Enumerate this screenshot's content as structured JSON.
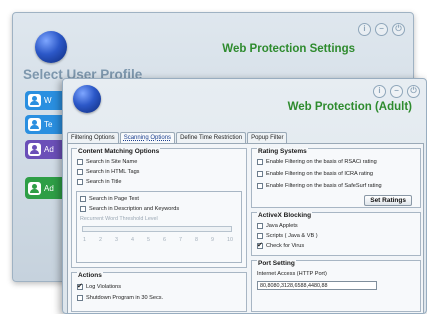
{
  "back_window": {
    "title": "Web Protection Settings",
    "heading": "Select User Profile",
    "controls": [
      "i",
      "−",
      "⏻"
    ],
    "users": [
      {
        "label": "W",
        "color": "#2a8fe0"
      },
      {
        "label": "Te",
        "color": "#2a8fe0"
      },
      {
        "label": "Ad",
        "color": "#6b4fb8"
      },
      {
        "label": "Ad",
        "color": "#2e9e46"
      }
    ]
  },
  "front_window": {
    "title": "Web Protection (Adult)",
    "controls": [
      "i",
      "−",
      "⏻"
    ],
    "tabs": [
      "Filtering Options",
      "Scanning Options",
      "Define Time Restriction",
      "Popup Filter"
    ],
    "active_tab_index": 1,
    "content_matching": {
      "title": "Content Matching Options",
      "options": [
        {
          "label": "Search in Site Name",
          "checked": false
        },
        {
          "label": "Search in HTML Tags",
          "checked": false
        },
        {
          "label": "Search in Title",
          "checked": false
        }
      ],
      "page_options": [
        {
          "label": "Search in Page Text",
          "checked": false
        },
        {
          "label": "Search in Description and Keywords",
          "checked": false
        }
      ],
      "threshold_label": "Recurrent Word Threshold Level",
      "ticks": [
        "1",
        "2",
        "3",
        "4",
        "5",
        "6",
        "7",
        "8",
        "9",
        "10"
      ]
    },
    "rating_systems": {
      "title": "Rating Systems",
      "options": [
        {
          "label": "Enable Filtering on the basis of RSACi rating",
          "checked": false
        },
        {
          "label": "Enable Filtering on the basis of ICRA rating",
          "checked": false
        },
        {
          "label": "Enable Filtering on the basis of SafeSurf rating",
          "checked": false
        }
      ],
      "button": "Set Ratings"
    },
    "activex": {
      "title": "ActiveX Blocking",
      "options": [
        {
          "label": "Java Applets",
          "checked": false
        },
        {
          "label": "Scripts ( Java & VB )",
          "checked": false
        },
        {
          "label": "Check for Virus",
          "checked": true
        }
      ]
    },
    "actions": {
      "title": "Actions",
      "options": [
        {
          "label": "Log Violations",
          "checked": true
        },
        {
          "label": "Shutdown Program in 30 Secs.",
          "checked": false
        }
      ]
    },
    "port_setting": {
      "title": "Port Setting",
      "field_label": "Internet Access (HTTP Port)",
      "field_value": "80,8080,3128,6588,4480,88"
    }
  }
}
